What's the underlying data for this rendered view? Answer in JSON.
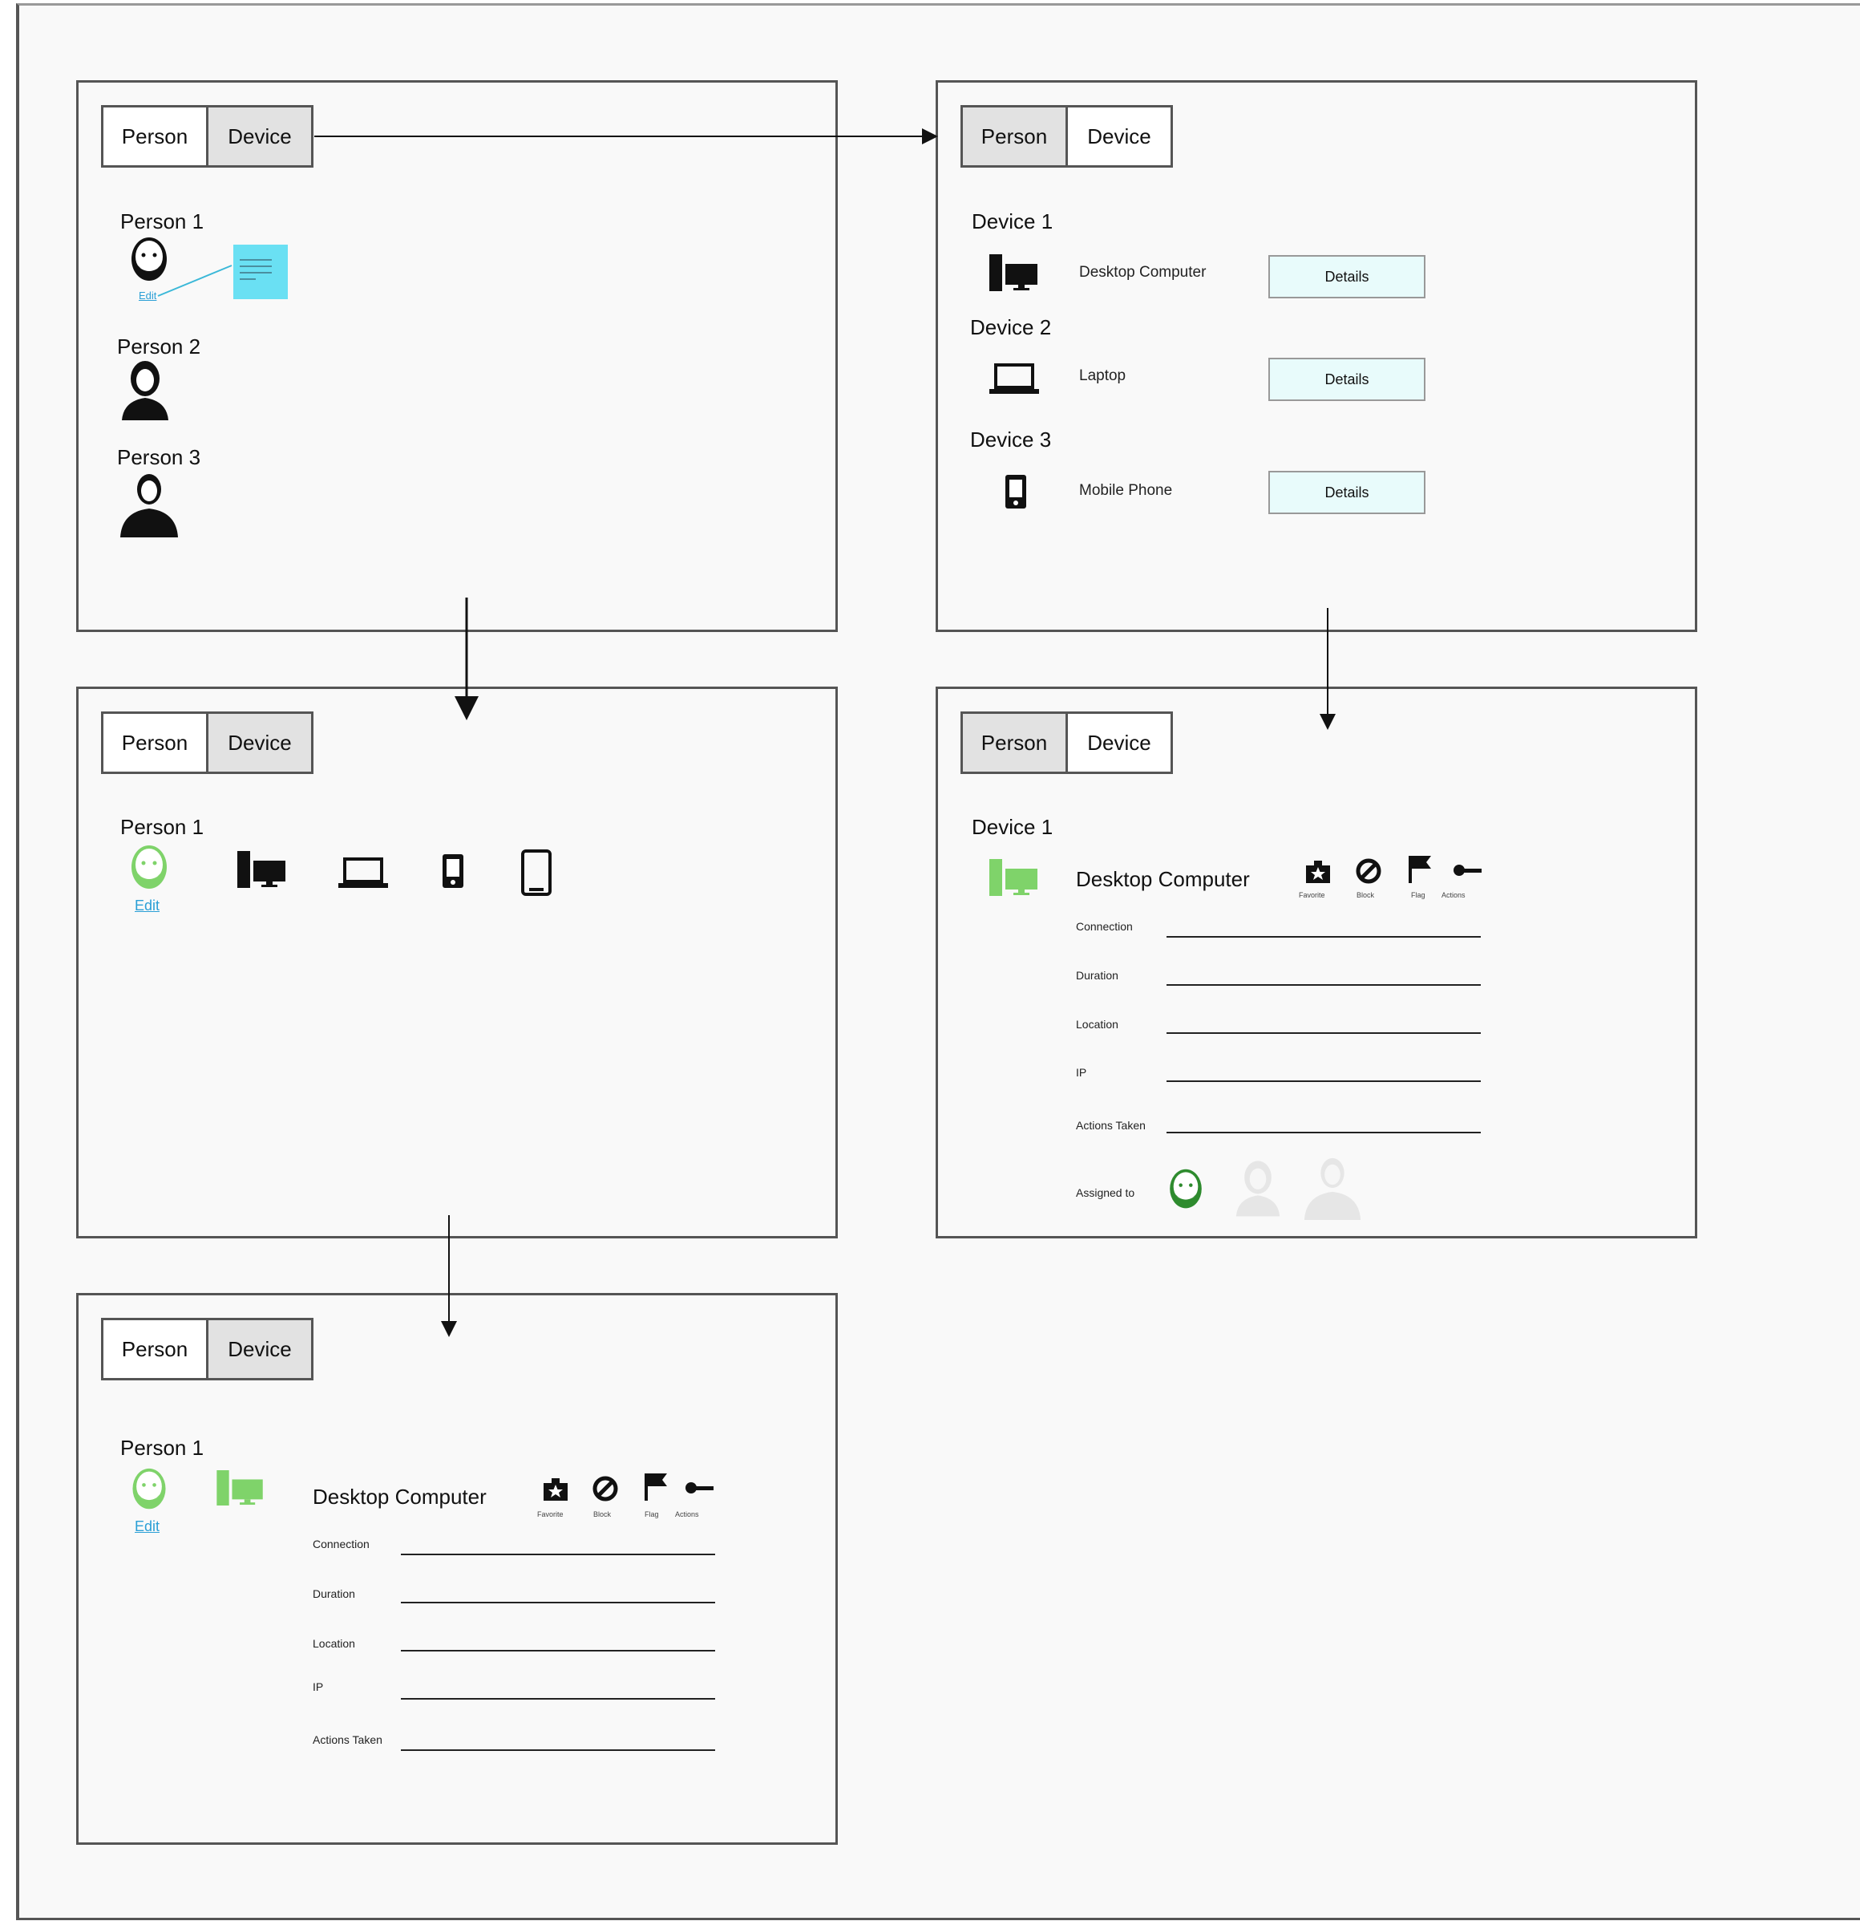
{
  "tabs": {
    "person": "Person",
    "device": "Device"
  },
  "panel1": {
    "people": [
      {
        "label": "Person 1"
      },
      {
        "label": "Person 2"
      },
      {
        "label": "Person 3"
      }
    ],
    "edit": "Edit"
  },
  "panel2": {
    "devices": [
      {
        "label": "Device 1",
        "name": "Desktop Computer",
        "button": "Details"
      },
      {
        "label": "Device 2",
        "name": "Laptop",
        "button": "Details"
      },
      {
        "label": "Device 3",
        "name": "Mobile Phone",
        "button": "Details"
      }
    ]
  },
  "panel3": {
    "person": "Person 1",
    "edit": "Edit"
  },
  "panel4": {
    "device": "Device 1",
    "title": "Desktop Computer",
    "actions": [
      "Favorite",
      "Block",
      "Flag",
      "Actions"
    ],
    "fields": [
      "Connection",
      "Duration",
      "Location",
      "IP",
      "Actions Taken"
    ],
    "assigned": "Assigned to"
  },
  "panel5": {
    "person": "Person 1",
    "edit": "Edit",
    "title": "Desktop Computer",
    "actions": [
      "Favorite",
      "Block",
      "Flag",
      "Actions"
    ],
    "fields": [
      "Connection",
      "Duration",
      "Location",
      "IP",
      "Actions Taken"
    ]
  },
  "colors": {
    "green": "#7fd36a",
    "darkgreen": "#2e8b2e",
    "cyan": "#6ae0f3",
    "button": "#e8fbfb"
  }
}
